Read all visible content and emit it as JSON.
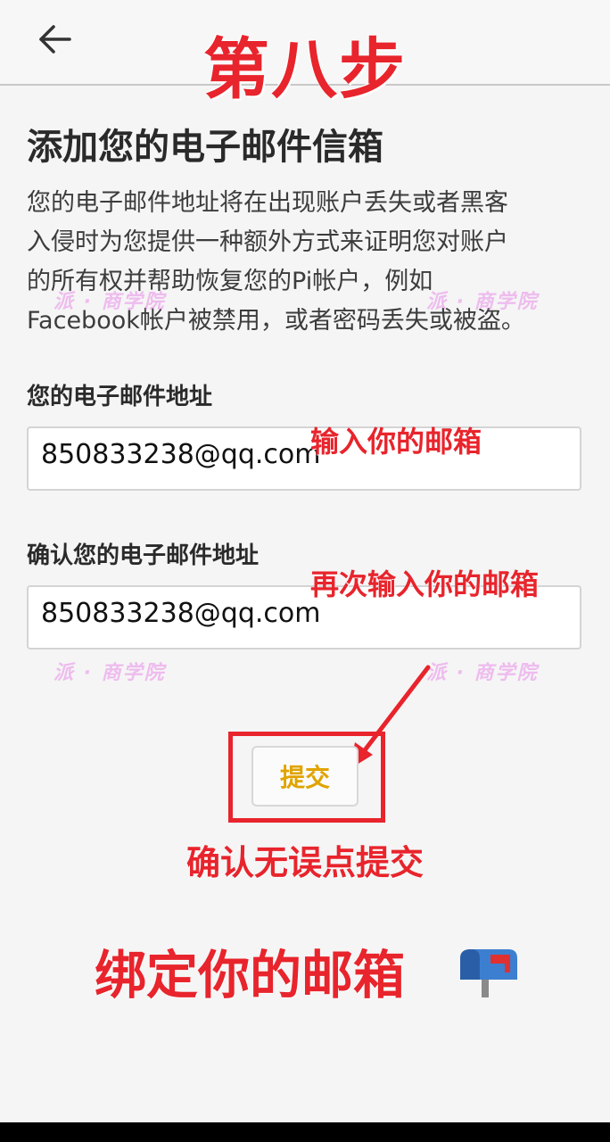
{
  "header": {
    "step_title": "第八步"
  },
  "page": {
    "title": "添加您的电子邮件信箱",
    "description_lines": [
      "您的电子邮件地址将在出现账户丢失或者黑客",
      "入侵时为您提供一种额外方式来证明您对账户",
      "的所有权并帮助恢复您的Pi帐户，例如",
      "Facebook帐户被禁用，或者密码丢失或被盗。"
    ],
    "email_label": "您的电子邮件地址",
    "email_value": "850833238@qq.com",
    "confirm_label": "确认您的电子邮件地址",
    "confirm_value": "850833238@qq.com",
    "submit_label": "提交"
  },
  "annotations": {
    "enter_email": "输入你的邮箱",
    "reenter_email": "再次输入你的邮箱",
    "confirm_submit": "确认无误点提交",
    "bind_email": "绑定你的邮箱"
  },
  "watermark": "派 · 商学院",
  "colors": {
    "annotation_red": "#e8242c",
    "submit_text": "#e0a400",
    "watermark": "#e678e6"
  }
}
